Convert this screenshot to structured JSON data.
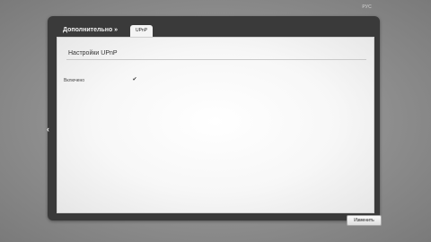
{
  "top_right_label": "РУС",
  "header": {
    "section_title": "Дополнительно »",
    "tab_label": "UPnP"
  },
  "content": {
    "title": "Настройки UPnP",
    "fields": [
      {
        "label": "Включено",
        "checked": true,
        "check_glyph": "✔"
      }
    ]
  },
  "buttons": {
    "apply_label": "Изменить"
  },
  "nav": {
    "back_glyph": "‹",
    "back_icon": "chevron-left-icon"
  }
}
